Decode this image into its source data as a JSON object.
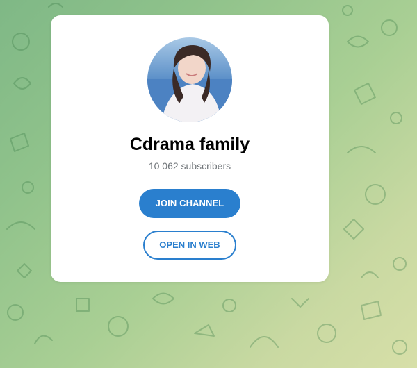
{
  "channel": {
    "title": "Cdrama family",
    "subscribers": "10 062 subscribers"
  },
  "actions": {
    "join_label": "JOIN CHANNEL",
    "open_web_label": "OPEN IN WEB"
  },
  "colors": {
    "accent": "#2a7fce",
    "card_background": "#ffffff",
    "muted_text": "#707579",
    "background_green": "#8fc28b"
  },
  "icons": {
    "avatar": "channel-avatar-photo",
    "background": "doodle-pattern"
  }
}
